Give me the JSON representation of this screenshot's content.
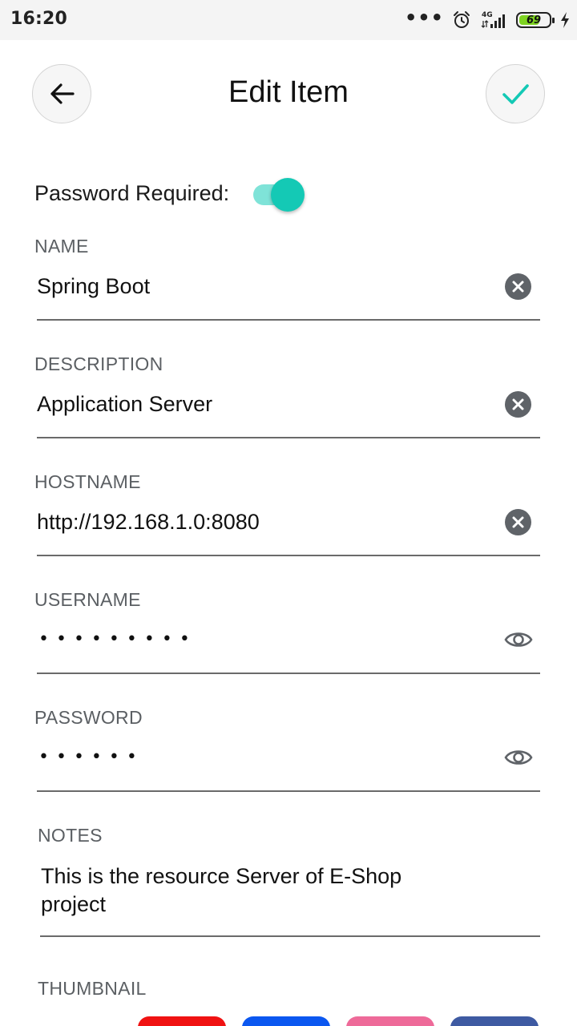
{
  "status_bar": {
    "time": "16:20",
    "network": "4G",
    "battery_level": "69",
    "icons": [
      "more-dots-icon",
      "alarm-icon",
      "signal-icon",
      "battery-icon",
      "charging-icon"
    ]
  },
  "header": {
    "title": "Edit Item",
    "back_icon": "arrow-left-icon",
    "save_icon": "check-icon"
  },
  "password_required": {
    "label": "Password Required:",
    "enabled": true
  },
  "fields": {
    "name": {
      "label": "NAME",
      "value": "Spring Boot"
    },
    "description": {
      "label": "DESCRIPTION",
      "value": "Application Server"
    },
    "hostname": {
      "label": "HOSTNAME",
      "value": "http://192.168.1.0:8080"
    },
    "username": {
      "label": "USERNAME",
      "value": "•••••••••"
    },
    "password": {
      "label": "PASSWORD",
      "value": "••••••"
    },
    "notes": {
      "label": "NOTES",
      "value": "This is the resource Server of E-Shop project"
    }
  },
  "thumbnail": {
    "label": "THUMBNAIL",
    "colors": [
      "#f01212",
      "#0b57f0",
      "#ee6a99",
      "#3e5aa2"
    ]
  },
  "colors": {
    "accent": "#14c9b5",
    "accent_light": "#7fe3d8"
  }
}
